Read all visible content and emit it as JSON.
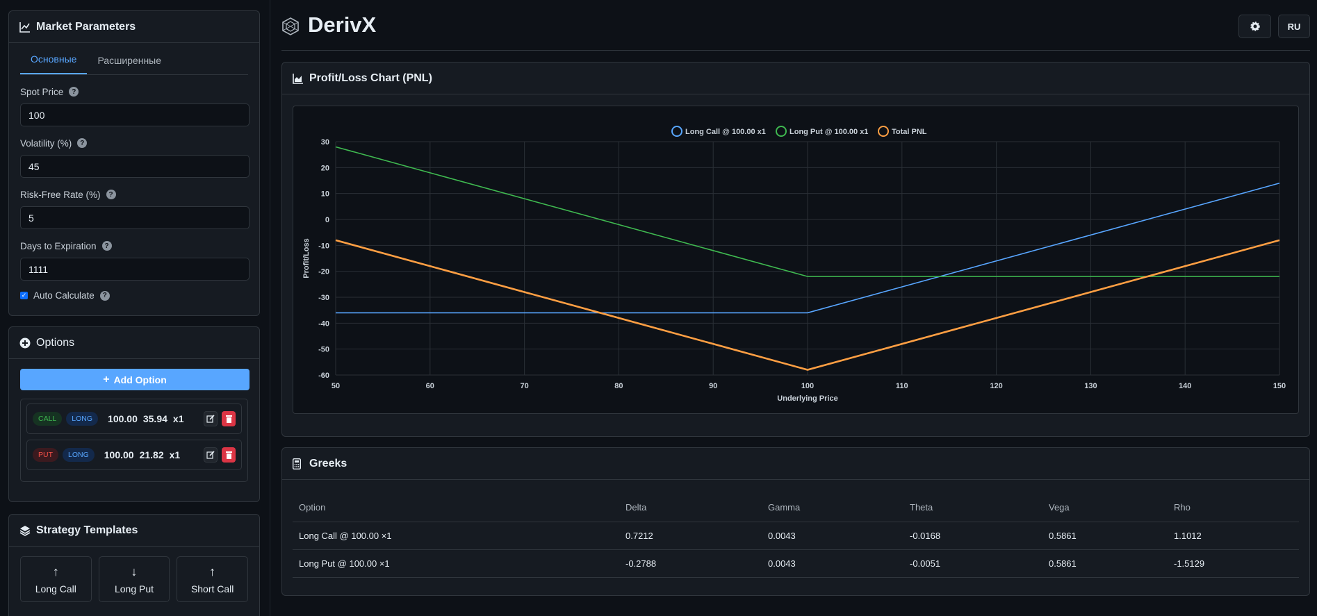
{
  "market": {
    "title": "Market Parameters",
    "tabs": [
      "Основные",
      "Расширенные"
    ],
    "fields": [
      {
        "label": "Spot Price",
        "value": "100"
      },
      {
        "label": "Volatility (%)",
        "value": "45"
      },
      {
        "label": "Risk-Free Rate (%)",
        "value": "5"
      },
      {
        "label": "Days to Expiration",
        "value": "1111"
      }
    ],
    "auto_calc": "Auto Calculate",
    "help": "?"
  },
  "options": {
    "title": "Options",
    "add_label": "Add Option",
    "rows": [
      {
        "type": "CALL",
        "side": "LONG",
        "strike": "100.00",
        "price": "35.94",
        "qty": "x1"
      },
      {
        "type": "PUT",
        "side": "LONG",
        "strike": "100.00",
        "price": "21.82",
        "qty": "x1"
      }
    ]
  },
  "templates": {
    "title": "Strategy Templates",
    "items": [
      {
        "label": "Long Call",
        "arrow": "↑"
      },
      {
        "label": "Long Put",
        "arrow": "↓"
      },
      {
        "label": "Short Call",
        "arrow": "↑"
      }
    ]
  },
  "header": {
    "brand": "DerivX",
    "lang": "RU"
  },
  "pnl": {
    "title": "Profit/Loss Chart (PNL)"
  },
  "chart_data": {
    "type": "line",
    "x": [
      50,
      100,
      150
    ],
    "xlabel": "Underlying Price",
    "ylabel": "Profit/Loss",
    "xlim": [
      50,
      150
    ],
    "ylim": [
      -60,
      30
    ],
    "xticks": [
      50,
      60,
      70,
      80,
      90,
      100,
      110,
      120,
      130,
      140,
      150
    ],
    "yticks": [
      30,
      20,
      10,
      0,
      -10,
      -20,
      -30,
      -40,
      -50,
      -60
    ],
    "grid": true,
    "legend_position": "top-center",
    "series": [
      {
        "name": "Long Call @ 100.00 x1",
        "color": "#58a6ff",
        "values": [
          -36,
          -36,
          14
        ]
      },
      {
        "name": "Long Put @ 100.00 x1",
        "color": "#3fb950",
        "values": [
          28,
          -22,
          -22
        ]
      },
      {
        "name": "Total PNL",
        "color": "#ff9f43",
        "values": [
          -8,
          -58,
          -8
        ]
      }
    ]
  },
  "greeks": {
    "title": "Greeks",
    "columns": [
      "Option",
      "Delta",
      "Gamma",
      "Theta",
      "Vega",
      "Rho"
    ],
    "rows": [
      [
        "Long Call @ 100.00 ×1",
        "0.7212",
        "0.0043",
        "-0.0168",
        "0.5861",
        "1.1012"
      ],
      [
        "Long Put @ 100.00 ×1",
        "-0.2788",
        "0.0043",
        "-0.0051",
        "0.5861",
        "-1.5129"
      ]
    ]
  }
}
